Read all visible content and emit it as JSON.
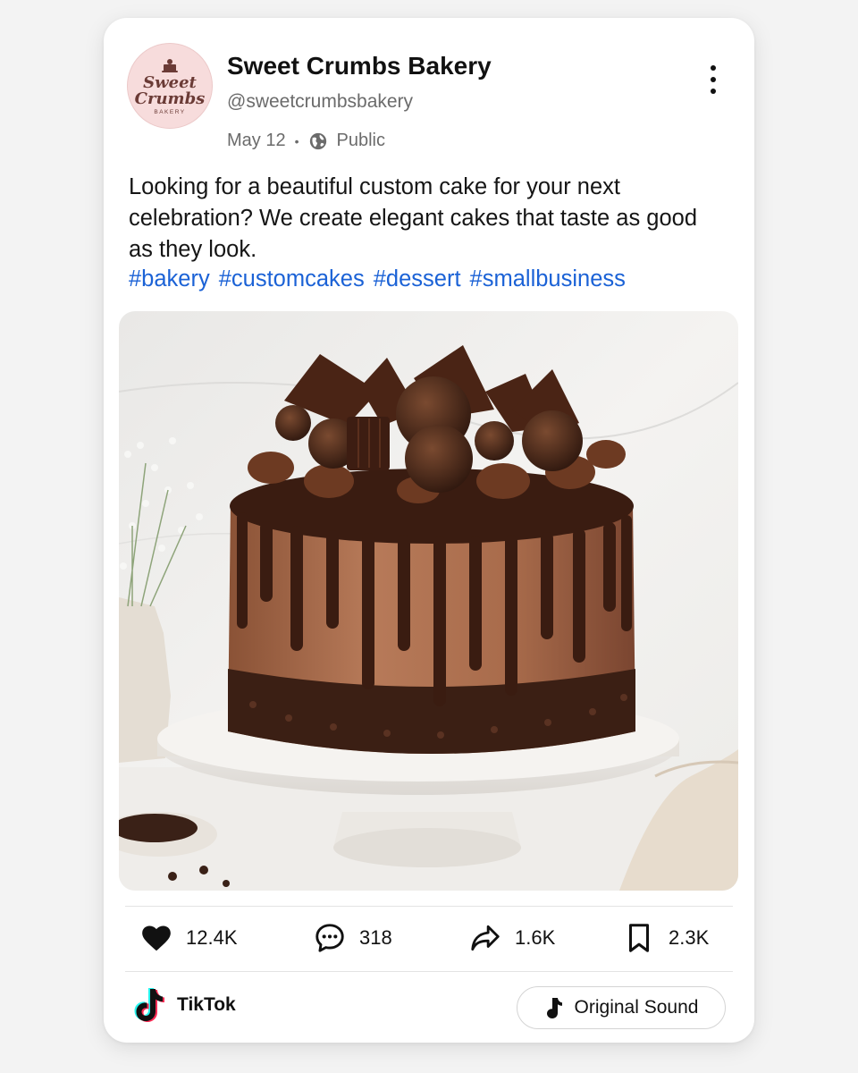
{
  "post": {
    "account_name": "Sweet Crumbs Bakery",
    "handle": "@sweetcrumbsbakery",
    "date": "May 12",
    "separator": "•",
    "visibility": "Public",
    "avatar_logo": {
      "line1": "Sweet",
      "line2": "Crumbs",
      "line3": "BAKERY"
    },
    "caption": "Looking for a beautiful custom cake for your next celebration? We create elegant cakes that taste as good as they look.",
    "hashtags": [
      "#bakery",
      "#customcakes",
      "#dessert",
      "#smallbusiness"
    ]
  },
  "actions": {
    "likes": "12.4K",
    "comments": "318",
    "shares": "1.6K",
    "saves": "2.3K"
  },
  "footer": {
    "platform": "TikTok",
    "sound_label": "Original Sound"
  },
  "icons": {
    "more": "more-vertical-icon",
    "visibility": "globe-icon",
    "like": "heart-icon",
    "comment": "comment-icon",
    "share": "share-icon",
    "save": "bookmark-icon",
    "platform": "tiktok-logo-icon",
    "sound": "music-note-icon"
  },
  "colors": {
    "hashtag": "#1b62d6",
    "avatar_bg": "#f7dcdc",
    "text_secondary": "#6b6b6b"
  }
}
